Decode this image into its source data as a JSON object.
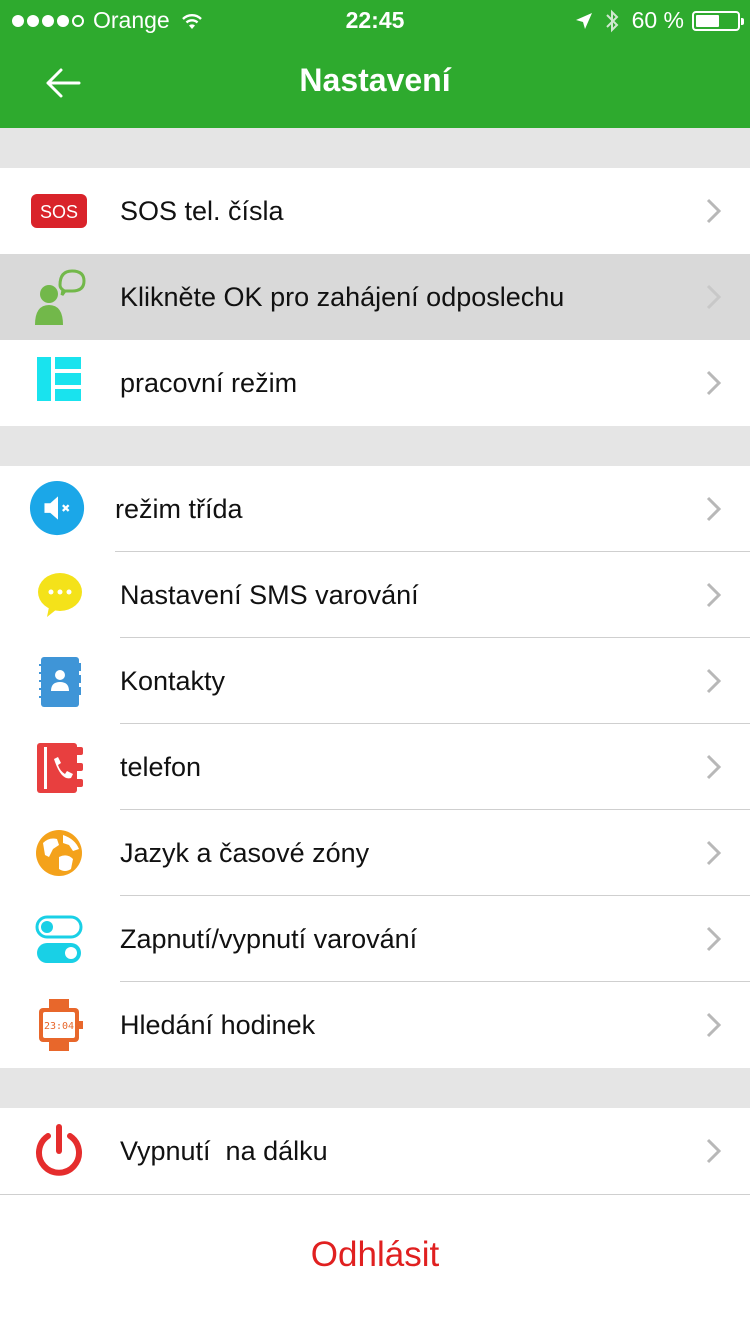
{
  "status_bar": {
    "carrier": "Orange",
    "time": "22:45",
    "battery": "60 %"
  },
  "nav": {
    "title": "Nastavení",
    "back_icon": "arrow-left-icon"
  },
  "colors": {
    "header": "#2eaa2e",
    "logout": "#e02020"
  },
  "section1": [
    {
      "label": "SOS tel. čísla",
      "icon": "sos-icon"
    },
    {
      "label": "Klikněte OK pro zahájení odposlechu",
      "icon": "listen-icon"
    },
    {
      "label": "pracovní režim",
      "icon": "work-mode-icon"
    }
  ],
  "section2": [
    {
      "label": "režim třída",
      "icon": "mute-icon"
    },
    {
      "label": "Nastavení SMS varování",
      "icon": "sms-bubble-icon"
    },
    {
      "label": "Kontakty",
      "icon": "contacts-book-icon"
    },
    {
      "label": "telefon",
      "icon": "phone-book-icon"
    },
    {
      "label": "Jazyk a časové zóny",
      "icon": "globe-icon"
    },
    {
      "label": "Zapnutí/vypnutí varování",
      "icon": "toggle-icon"
    },
    {
      "label": "Hledání hodinek",
      "icon": "watch-icon"
    }
  ],
  "section3": [
    {
      "label": "Vypnutí  na dálku",
      "icon": "power-icon"
    }
  ],
  "logout_label": "Odhlásit"
}
